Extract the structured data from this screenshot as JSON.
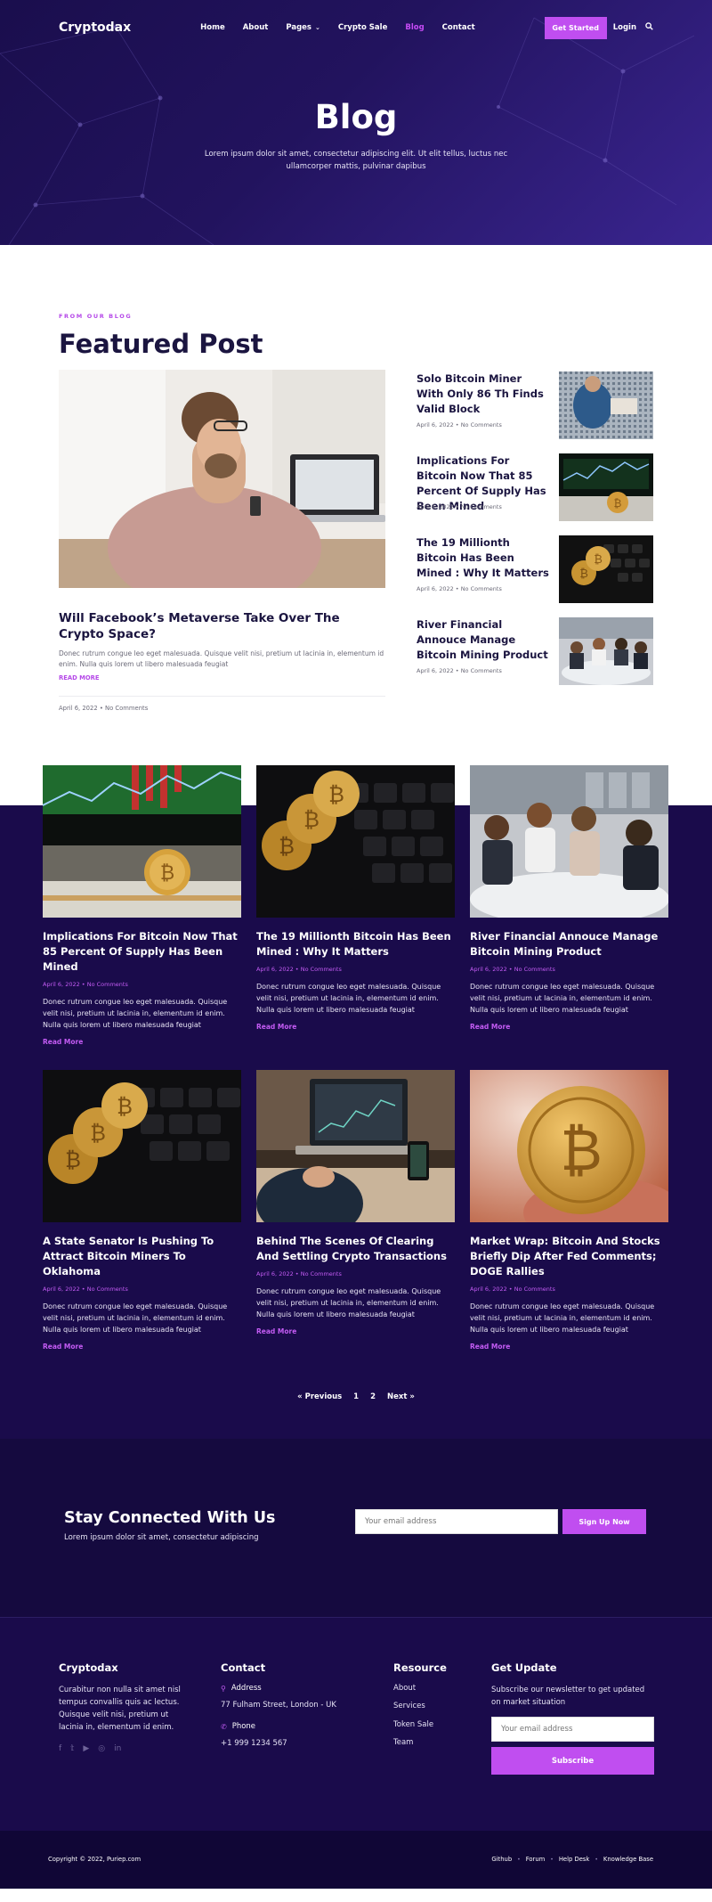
{
  "brand": "Cryptodax",
  "nav": {
    "items": [
      "Home",
      "About",
      "Pages",
      "Crypto Sale",
      "Blog",
      "Contact"
    ],
    "active": "Blog",
    "cta": "Get Started",
    "login": "Login"
  },
  "hero": {
    "title": "Blog",
    "subtitle": "Lorem ipsum dolor sit amet, consectetur adipiscing elit. Ut elit tellus, luctus nec ullamcorper mattis, pulvinar dapibus"
  },
  "featured": {
    "eyebrow": "FROM OUR BLOG",
    "heading": "Featured Post",
    "main": {
      "title": "Will Facebook’s Metaverse Take Over The Crypto Space?",
      "excerpt": "Donec rutrum congue leo eget malesuada. Quisque velit nisi, pretium ut lacinia in, elementum id enim. Nulla quis lorem ut libero malesuada feugiat",
      "read_more": "READ MORE",
      "date": "April 6, 2022",
      "comments": "No Comments"
    },
    "side": [
      {
        "title": "Solo Bitcoin Miner With Only 86 Th Finds Valid Block",
        "meta": "April 6, 2022 • No Comments"
      },
      {
        "title": "Implications For Bitcoin Now That 85 Percent Of Supply Has Been Mined",
        "meta": "April 6, 2022 • No Comments"
      },
      {
        "title": "The 19 Millionth Bitcoin Has Been Mined : Why It Matters",
        "meta": "April 6, 2022 • No Comments"
      },
      {
        "title": "River Financial Annouce Manage Bitcoin Mining Product",
        "meta": "April 6, 2022 • No Comments"
      }
    ]
  },
  "posts": [
    {
      "title": "Implications For Bitcoin Now That 85 Percent Of Supply Has Been Mined",
      "date": "April 6, 2022",
      "comments": "No Comments",
      "excerpt": "Donec rutrum congue leo eget malesuada. Quisque velit nisi, pretium ut lacinia in, elementum id enim. Nulla quis lorem ut libero malesuada feugiat",
      "read_more": "Read More"
    },
    {
      "title": "The 19 Millionth Bitcoin Has Been Mined : Why It Matters",
      "date": "April 6, 2022",
      "comments": "No Comments",
      "excerpt": "Donec rutrum congue leo eget malesuada. Quisque velit nisi, pretium ut lacinia in, elementum id enim. Nulla quis lorem ut libero malesuada feugiat",
      "read_more": "Read More"
    },
    {
      "title": "River Financial Annouce Manage Bitcoin Mining Product",
      "date": "April 6, 2022",
      "comments": "No Comments",
      "excerpt": "Donec rutrum congue leo eget malesuada. Quisque velit nisi, pretium ut lacinia in, elementum id enim. Nulla quis lorem ut libero malesuada feugiat",
      "read_more": "Read More"
    },
    {
      "title": "A State Senator Is Pushing To Attract Bitcoin Miners To Oklahoma",
      "date": "April 6, 2022",
      "comments": "No Comments",
      "excerpt": "Donec rutrum congue leo eget malesuada. Quisque velit nisi, pretium ut lacinia in, elementum id enim. Nulla quis lorem ut libero malesuada feugiat",
      "read_more": "Read More"
    },
    {
      "title": "Behind The Scenes Of Clearing And Settling Crypto Transactions",
      "date": "April 6, 2022",
      "comments": "No Comments",
      "excerpt": "Donec rutrum congue leo eget malesuada. Quisque velit nisi, pretium ut lacinia in, elementum id enim. Nulla quis lorem ut libero malesuada feugiat",
      "read_more": "Read More"
    },
    {
      "title": "Market Wrap: Bitcoin And Stocks Briefly Dip After Fed Comments; DOGE Rallies",
      "date": "April 6, 2022",
      "comments": "No Comments",
      "excerpt": "Donec rutrum congue leo eget malesuada. Quisque velit nisi, pretium ut lacinia in, elementum id enim. Nulla quis lorem ut libero malesuada feugiat",
      "read_more": "Read More"
    }
  ],
  "pagination": {
    "prev": "« Previous",
    "pages": [
      "1",
      "2"
    ],
    "next": "Next »"
  },
  "subscribe": {
    "title": "Stay Connected With Us",
    "text": "Lorem ipsum dolor sit amet, consectetur adipiscing",
    "placeholder": "Your email address",
    "button": "Sign Up Now"
  },
  "footer": {
    "about_title": "Cryptodax",
    "about_text": "Curabitur non nulla sit amet nisl tempus convallis quis ac lectus. Quisque velit nisi, pretium ut lacinia in, elementum id enim.",
    "contact_title": "Contact",
    "address_label": "Address",
    "address": "77 Fulham Street, London - UK",
    "phone_label": "Phone",
    "phone": "+1 999 1234 567",
    "resource_title": "Resource",
    "resources": [
      "About",
      "Services",
      "Token Sale",
      "Team"
    ],
    "update_title": "Get Update",
    "update_text": "Subscribe our newsletter to get updated on market situation",
    "update_placeholder": "Your email address",
    "update_button": "Subscribe"
  },
  "bottom": {
    "copyright": "Copyright © 2022, Puriep.com",
    "links": [
      "Github",
      "Forum",
      "Help Desk",
      "Knowledge Base"
    ]
  },
  "colors": {
    "accent": "#c04ef0",
    "dark_bg": "#1a0b4b",
    "heading": "#1b1540"
  }
}
